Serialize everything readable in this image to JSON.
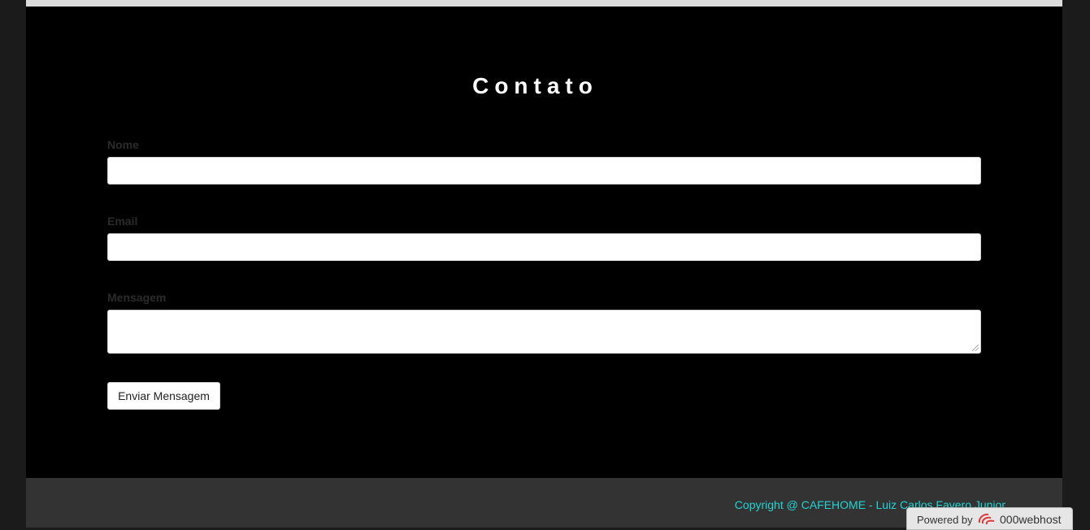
{
  "contact": {
    "title": "Contato",
    "fields": {
      "name_label": "Nome",
      "name_value": "",
      "email_label": "Email",
      "email_value": "",
      "message_label": "Mensagem",
      "message_value": ""
    },
    "submit_label": "Enviar Mensagem"
  },
  "footer": {
    "copyright": "Copyright @ CAFEHOME - Luiz Carlos Favero Junior"
  },
  "badge": {
    "powered_by": "Powered by",
    "brand": "000webhost",
    "logo_icon": "000webhost-swirl-icon"
  },
  "colors": {
    "background": "#000000",
    "footer": "#333333",
    "copyright_text": "#20d4d4"
  }
}
